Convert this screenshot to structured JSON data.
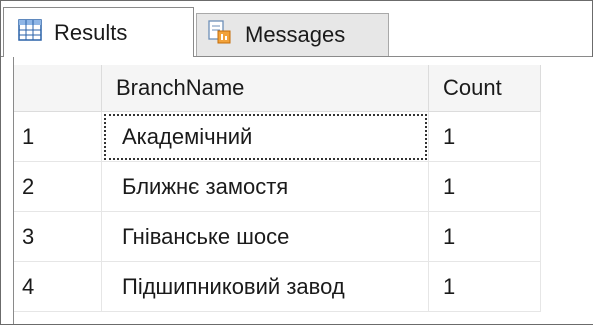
{
  "tabs": {
    "results": {
      "label": "Results",
      "icon": "grid-icon"
    },
    "messages": {
      "label": "Messages",
      "icon": "messages-icon"
    }
  },
  "table": {
    "columns": [
      "BranchName",
      "Count"
    ],
    "rows": [
      {
        "num": "1",
        "branch": "Академічний",
        "count": "1"
      },
      {
        "num": "2",
        "branch": "Ближнє замостя",
        "count": "1"
      },
      {
        "num": "3",
        "branch": "Гніванське шосе",
        "count": "1"
      },
      {
        "num": "4",
        "branch": "Підшипниковий завод",
        "count": "1"
      }
    ]
  }
}
